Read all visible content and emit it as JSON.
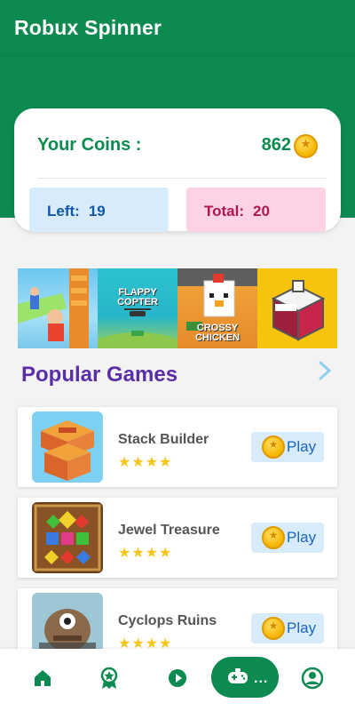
{
  "app": {
    "title": "Robux Spinner"
  },
  "coins": {
    "label": "Your Coins :",
    "value": "862",
    "icon": "coin-star-icon"
  },
  "stats": {
    "left_label": "Left:",
    "left_value": "19",
    "total_label": "Total:",
    "total_value": "20"
  },
  "banner": {
    "tiles": [
      {
        "name": "stack-game-art"
      },
      {
        "name": "flappy-copter-art",
        "text": "FLAPPY COPTER"
      },
      {
        "name": "crossy-chicken-art",
        "text": "CROSSY CHICKEN"
      },
      {
        "name": "house-game-art"
      }
    ]
  },
  "section": {
    "title": "Popular Games",
    "more_icon": "chevron-right-icon"
  },
  "games": [
    {
      "name": "Stack Builder",
      "stars": "★★★★",
      "play_label": "Play"
    },
    {
      "name": "Jewel Treasure",
      "stars": "★★★★",
      "play_label": "Play"
    },
    {
      "name": "Cyclops Ruins",
      "stars": "★★★★",
      "play_label": "Play"
    }
  ],
  "nav": {
    "items": [
      "home-icon",
      "badge-icon",
      "play-circle-icon",
      "gamepad-icon",
      "profile-icon"
    ],
    "fab_dots": "..."
  },
  "colors": {
    "primary": "#0c8a4f",
    "purple": "#5a2ea6",
    "left_bg": "#d7ebfb",
    "total_bg": "#fcd2e4"
  }
}
